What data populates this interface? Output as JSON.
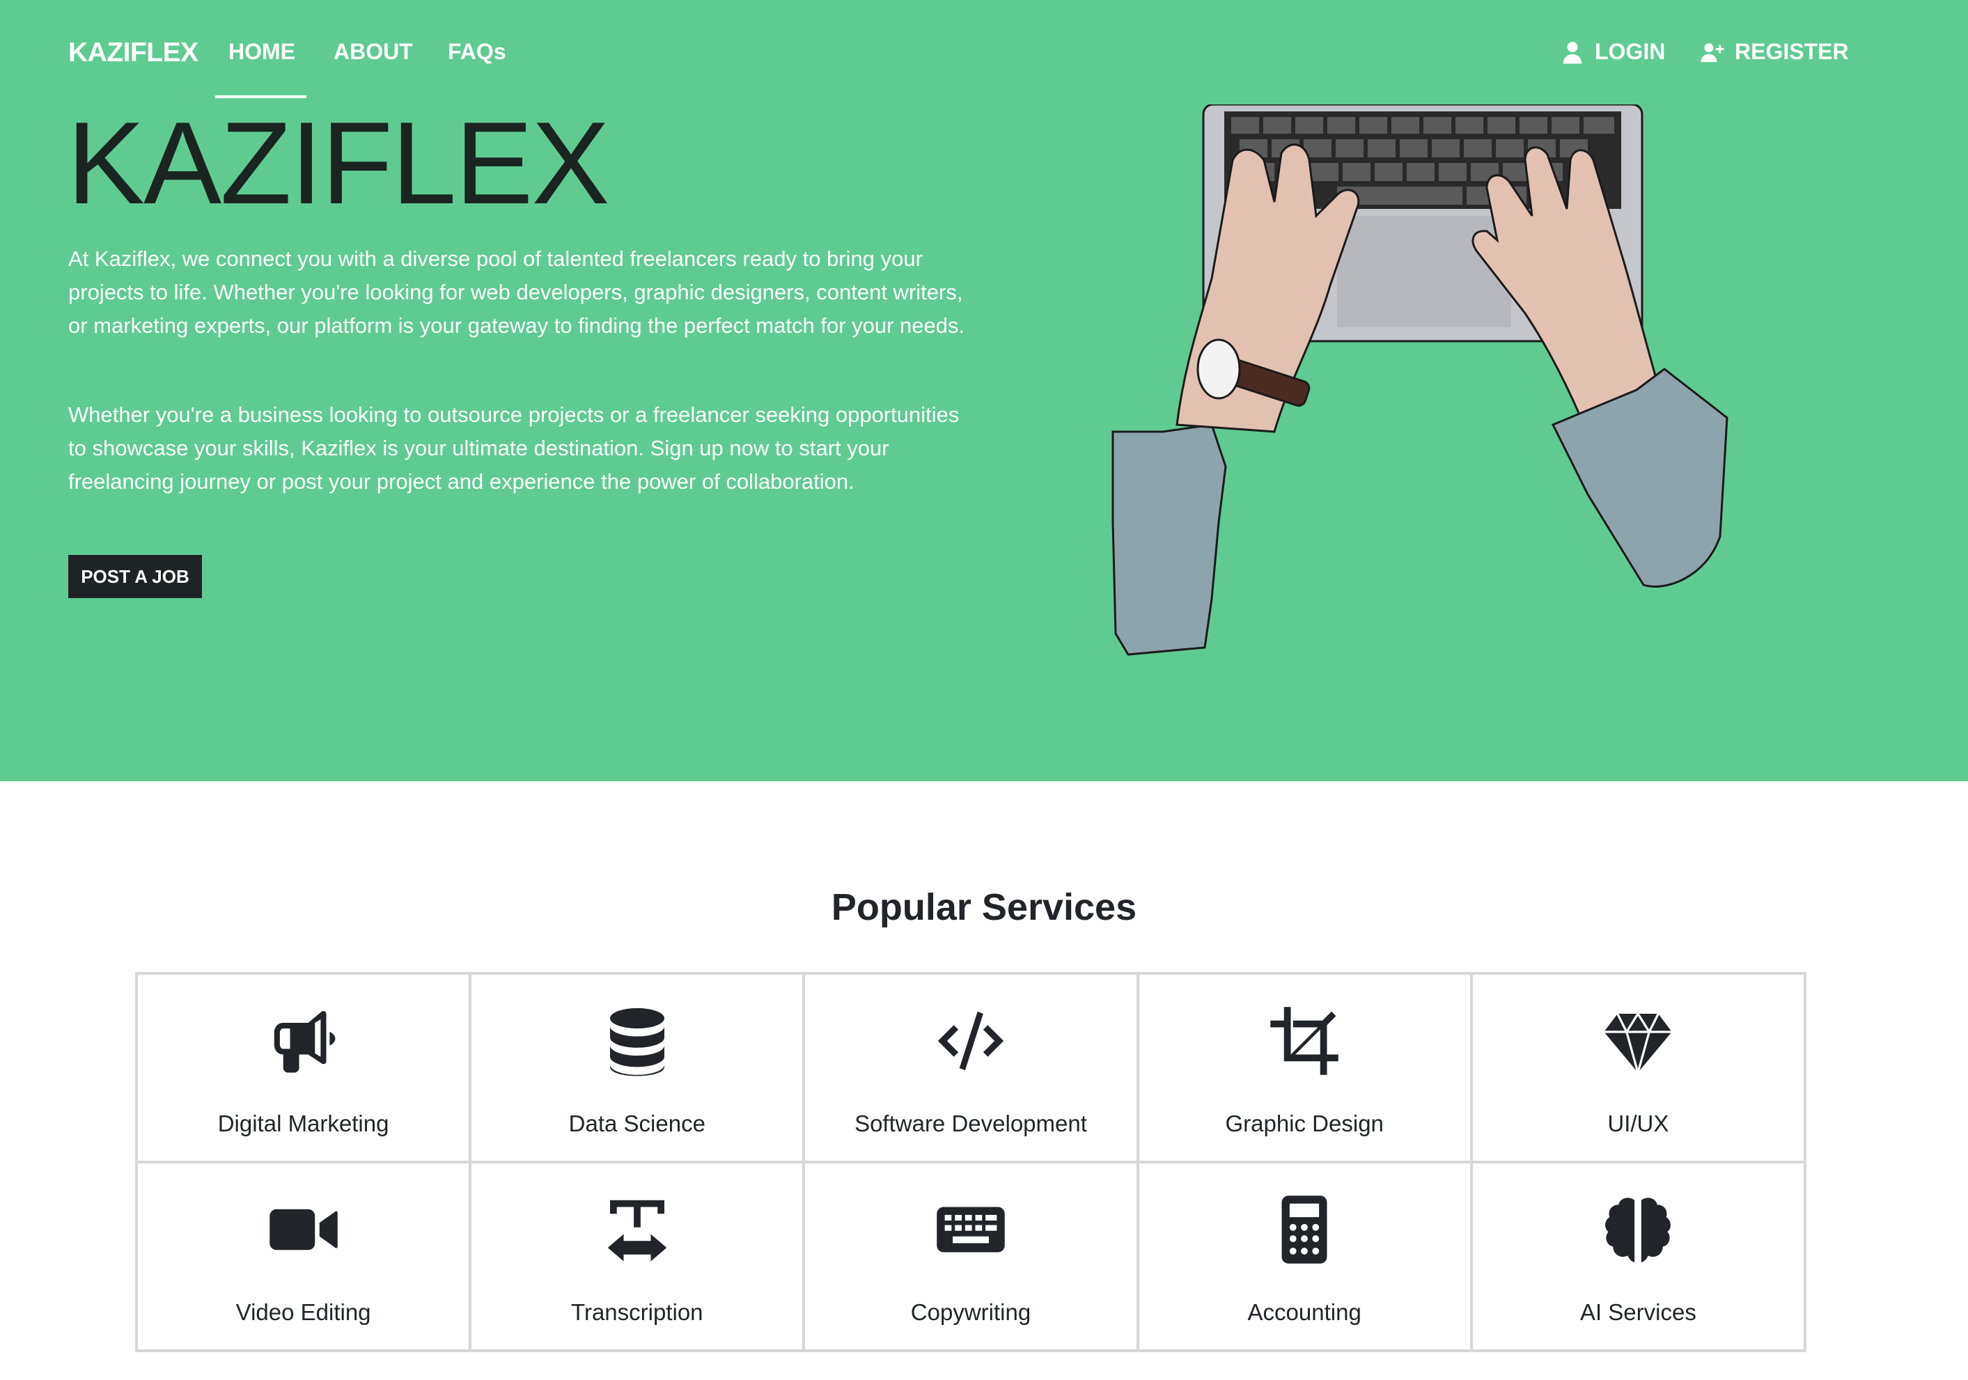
{
  "nav": {
    "brand": "KAZIFLEX",
    "links": [
      "HOME",
      "ABOUT",
      "FAQs"
    ],
    "login": "LOGIN",
    "register": "REGISTER"
  },
  "hero": {
    "title": "KAZIFLEX",
    "paragraph1": "At Kaziflex, we connect you with a diverse pool of talented freelancers ready to bring your projects to life. Whether you're looking for web developers, graphic designers, content writers, or marketing experts, our platform is your gateway to finding the perfect match for your needs.",
    "paragraph2": "Whether you're a business looking to outsource projects or a freelancer seeking opportunities to showcase your skills, Kaziflex is your ultimate destination. Sign up now to start your freelancing journey or post your project and experience the power of collaboration.",
    "cta": "POST A JOB"
  },
  "services": {
    "title": "Popular Services",
    "items": [
      {
        "label": "Digital Marketing",
        "icon": "bullhorn-icon"
      },
      {
        "label": "Data Science",
        "icon": "database-icon"
      },
      {
        "label": "Software Development",
        "icon": "code-icon"
      },
      {
        "label": "Graphic Design",
        "icon": "crop-icon"
      },
      {
        "label": "UI/UX",
        "icon": "gem-icon"
      },
      {
        "label": "Video Editing",
        "icon": "video-icon"
      },
      {
        "label": "Transcription",
        "icon": "text-width-icon"
      },
      {
        "label": "Copywriting",
        "icon": "keyboard-icon"
      },
      {
        "label": "Accounting",
        "icon": "calculator-icon"
      },
      {
        "label": "AI Services",
        "icon": "brain-icon"
      }
    ]
  },
  "colors": {
    "hero_bg": "#5fcb92",
    "dark": "#212529",
    "cta_bg": "#1e2426"
  }
}
